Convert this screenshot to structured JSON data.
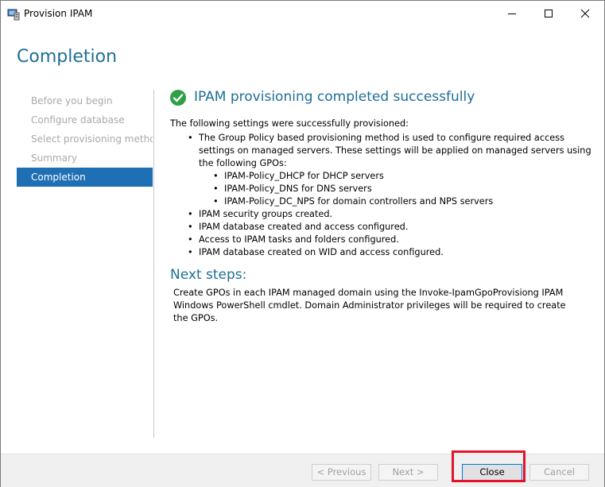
{
  "window": {
    "title": "Provision IPAM",
    "app_icon": "server-manager-icon",
    "controls": [
      "minimize-icon",
      "maximize-icon",
      "close-icon"
    ]
  },
  "header": {
    "title": "Completion"
  },
  "sidebar": {
    "items": [
      {
        "label": "Before you begin",
        "state": "disabled"
      },
      {
        "label": "Configure database",
        "state": "disabled"
      },
      {
        "label": "Select provisioning method",
        "state": "disabled"
      },
      {
        "label": "Summary",
        "state": "disabled"
      },
      {
        "label": "Completion",
        "state": "active"
      }
    ]
  },
  "main": {
    "status_icon": "success-check-icon",
    "status_title": "IPAM provisioning completed successfully",
    "intro": "The following settings were successfully provisioned:",
    "bullets": [
      "The Group Policy based provisioning method is used to configure required access settings on managed servers. These settings will be applied on managed servers using the following GPOs:",
      "IPAM security groups created.",
      "IPAM database created and access configured.",
      "Access to IPAM tasks and folders configured.",
      "IPAM database created on WID and access configured."
    ],
    "gpo_items": [
      "IPAM-Policy_DHCP for DHCP servers",
      "IPAM-Policy_DNS for DNS servers",
      "IPAM-Policy_DC_NPS for domain controllers and NPS servers"
    ],
    "next_steps_heading": "Next steps:",
    "next_steps_body": "Create GPOs in each IPAM managed domain using the Invoke-IpamGpoProvisiong IPAM Windows PowerShell cmdlet. Domain Administrator privileges will be required to create the GPOs."
  },
  "footer": {
    "previous_label": "< Previous",
    "next_label": "Next >",
    "close_label": "Close",
    "cancel_label": "Cancel"
  },
  "colors": {
    "accent": "#1e6e96",
    "nav_active": "#1f6fb4",
    "success": "#2ea043",
    "highlight": "#e3132b"
  }
}
